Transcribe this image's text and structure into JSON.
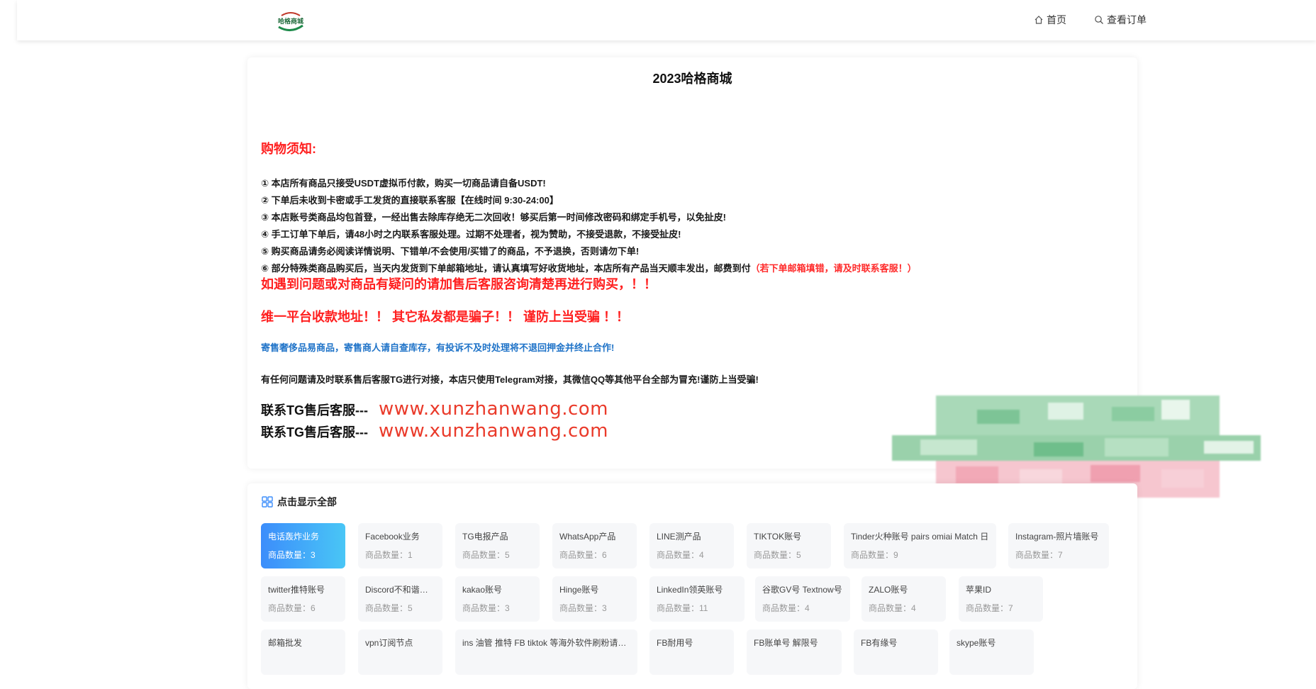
{
  "header": {
    "logo_text": "哈格商城",
    "nav": [
      {
        "label": "首页",
        "icon": "home-icon"
      },
      {
        "label": "查看订单",
        "icon": "search-icon"
      }
    ]
  },
  "announcement": {
    "title": "2023哈格商城",
    "notice_heading": "购物须知:",
    "rules": [
      "① 本店所有商品只接受USDT虚拟币付款，购买一切商品请自备USDT!",
      "② 下单后未收到卡密或手工发货的直接联系客服【在线时间 9:30-24:00】",
      "③ 本店账号类商品均包首登，一经出售去除库存绝无二次回收！够买后第一时间修改密码和绑定手机号，以免扯皮!",
      "④ 手工订单下单后，请48小时之内联系客服处理。过期不处理者，视为赞助，不接受退款，不接受扯皮!",
      "⑤ 购买商品请务必阅读详情说明、下错单/不会使用/买错了的商品，不予退换，否则请勿下单!",
      "⑥ 部分特殊类商品购买后，当天内发货到下单邮箱地址，请认真填写好收货地址，本店所有产品当天顺丰发出，邮费到付"
    ],
    "rule6_red": "（若下单邮箱填错，请及时联系客服！）",
    "warning1": "如遇到问题或对商品有疑问的请加售后客服咨询清楚再进行购买，！！",
    "warning2": "维一平台收款地址！！ 其它私发都是骗子！！ 谨防上当受骗 ！！",
    "consign_note": "寄售奢侈品易商品，寄售商人请自查库存，有投诉不及时处理将不退回押金并终止合作!",
    "telegram_note": "有任何问题请及时联系售后客服TG进行对接，本店只使用Telegram对接，其微信QQ等其他平台全部为冒充!谨防上当受骗!",
    "contacts": [
      {
        "label": "联系TG售后客服---",
        "url": "www.xunzhanwang.com"
      },
      {
        "label": "联系TG售后客服---",
        "url": "www.xunzhanwang.com"
      }
    ]
  },
  "categories": {
    "show_all_label": "点击显示全部",
    "count_label": "商品数量：",
    "items": [
      {
        "name": "电话轰炸业务",
        "count": "3",
        "active": true
      },
      {
        "name": "Facebook业务",
        "count": "1"
      },
      {
        "name": "TG电报产品",
        "count": "5"
      },
      {
        "name": "WhatsApp产品",
        "count": "6"
      },
      {
        "name": "LINE测产品",
        "count": "4"
      },
      {
        "name": "TIKTOK账号",
        "count": "5"
      },
      {
        "name": "Tinder火种账号 pairs omiai Match 日",
        "count": "9"
      },
      {
        "name": "Instagram-照片墙账号",
        "count": "7"
      },
      {
        "name": "twitter推特账号",
        "count": "6"
      },
      {
        "name": "Discord不和谐账号",
        "count": "5"
      },
      {
        "name": "kakao账号",
        "count": "3"
      },
      {
        "name": "Hinge账号",
        "count": "3"
      },
      {
        "name": "LinkedIn领英账号",
        "count": "11"
      },
      {
        "name": "谷歌GV号 Textnow号",
        "count": "4"
      },
      {
        "name": "ZALO账号",
        "count": "4"
      },
      {
        "name": "苹果ID",
        "count": "7"
      },
      {
        "name": "邮箱批发",
        "count": ""
      },
      {
        "name": "vpn订阅节点",
        "count": ""
      },
      {
        "name": "ins 油管 推特 FB tiktok 等海外软件刷粉请联系",
        "count": ""
      },
      {
        "name": "FB耐用号",
        "count": ""
      },
      {
        "name": "FB账单号 解限号",
        "count": ""
      },
      {
        "name": "FB有缘号",
        "count": ""
      },
      {
        "name": "skype账号",
        "count": ""
      }
    ]
  },
  "colors": {
    "accent_red": "#ff1f1f",
    "link_blue": "#1f73c8",
    "url_red": "#ea3a2a",
    "active_gradient_start": "#3c8dfb",
    "active_gradient_end": "#49c6f6"
  }
}
